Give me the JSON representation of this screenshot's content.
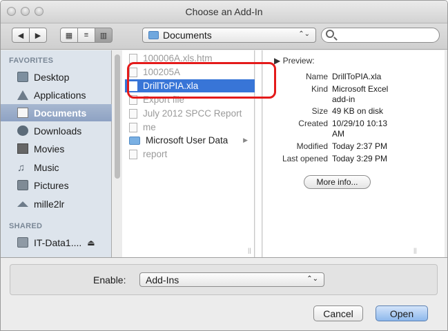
{
  "window": {
    "title": "Choose an Add-In"
  },
  "toolbar": {
    "back_glyph": "◀",
    "forward_glyph": "▶",
    "icon_view_glyph": "▦",
    "list_view_glyph": "≡",
    "column_view_glyph": "▥",
    "location": "Documents",
    "location_arrows": "⌃⌄",
    "search_placeholder": ""
  },
  "sidebar": {
    "favorites_header": "FAVORITES",
    "shared_header": "SHARED",
    "items": [
      {
        "label": "Desktop",
        "icon": "desktop-icon"
      },
      {
        "label": "Applications",
        "icon": "applications-icon"
      },
      {
        "label": "Documents",
        "icon": "documents-icon",
        "selected": true
      },
      {
        "label": "Downloads",
        "icon": "downloads-icon"
      },
      {
        "label": "Movies",
        "icon": "movies-icon"
      },
      {
        "label": "Music",
        "icon": "music-icon"
      },
      {
        "label": "Pictures",
        "icon": "pictures-icon"
      },
      {
        "label": "mille2lr",
        "icon": "home-icon"
      }
    ],
    "shared_items": [
      {
        "label": "IT-Data1.... ",
        "eject": "⏏"
      }
    ]
  },
  "files": [
    {
      "name": "100006A.xls.htm",
      "type": "file",
      "dimmed": true
    },
    {
      "name": "100205A",
      "type": "file",
      "dimmed": true
    },
    {
      "name": "DrillToPIA.xla",
      "type": "excel-addin",
      "selected": true
    },
    {
      "name": "Export file",
      "type": "file",
      "dimmed": true
    },
    {
      "name": "July 2012 SPCC Report",
      "type": "file",
      "dimmed": true
    },
    {
      "name": "me",
      "type": "file",
      "dimmed": true
    },
    {
      "name": "Microsoft User Data",
      "type": "folder"
    },
    {
      "name": "report",
      "type": "file",
      "dimmed": true
    }
  ],
  "preview": {
    "header": "Preview:",
    "name_label": "Name",
    "name_value": "DrillToPIA.xla",
    "kind_label": "Kind",
    "kind_value_1": "Microsoft Excel",
    "kind_value_2": "add-in",
    "size_label": "Size",
    "size_value": "49 KB on disk",
    "created_label": "Created",
    "created_value_1": "10/29/10 10:13",
    "created_value_2": "AM",
    "modified_label": "Modified",
    "modified_value": "Today 2:37 PM",
    "last_opened_label": "Last opened",
    "last_opened_value": "Today 3:29 PM",
    "more_info_button": "More info..."
  },
  "footer": {
    "enable_label": "Enable:",
    "enable_value": "Add-Ins",
    "enable_arrows": "⌃⌄",
    "cancel_button": "Cancel",
    "open_button": "Open"
  },
  "colors": {
    "selection": "#3875d7",
    "annotation": "#e41a1a",
    "sidebar_bg": "#dde4ec"
  }
}
